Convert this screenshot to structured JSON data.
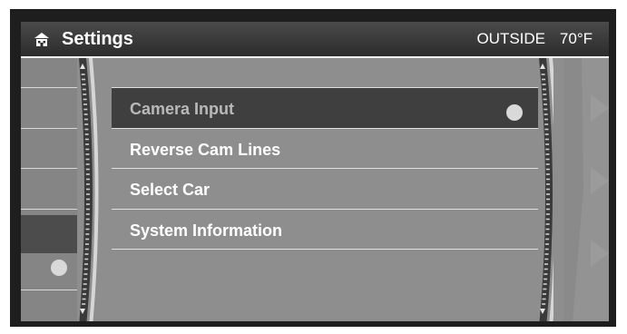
{
  "header": {
    "title": "Settings",
    "outside_label": "OUTSIDE",
    "temperature": "70°F",
    "home_icon": "home-icon"
  },
  "menu": {
    "items": [
      {
        "label": "Camera Input",
        "selected": true
      },
      {
        "label": "Reverse Cam Lines",
        "selected": false
      },
      {
        "label": "Select Car",
        "selected": false
      },
      {
        "label": "System Information",
        "selected": false
      }
    ]
  },
  "colors": {
    "background": "#8e8e8e",
    "header": "#2c2c2c",
    "selected_row": "#3f3f3f",
    "text": "#ffffff"
  }
}
